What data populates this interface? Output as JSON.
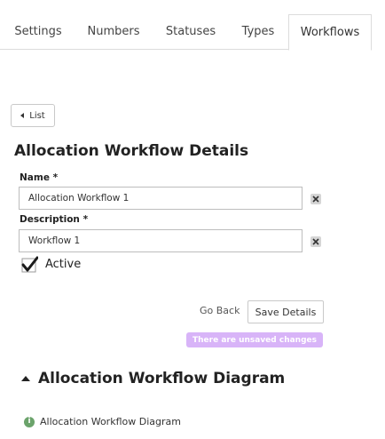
{
  "tabs": [
    {
      "label": "Settings"
    },
    {
      "label": "Numbers"
    },
    {
      "label": "Statuses"
    },
    {
      "label": "Types"
    },
    {
      "label": "Workflows"
    }
  ],
  "active_tab": "Workflows",
  "back_button": {
    "label": "List",
    "icon": "caret-left-icon"
  },
  "page_title": "Allocation Workflow Details",
  "form": {
    "name_label": "Name *",
    "name_value": "Allocation Workflow 1",
    "description_label": "Description *",
    "description_value": "Workflow 1",
    "clear_icon": "clear-x-icon",
    "active_label": "Active",
    "active_checked": true
  },
  "actions": {
    "go_back_label": "Go Back",
    "save_label": "Save Details",
    "unsaved_notice": "There are unsaved changes"
  },
  "diagram_section": {
    "title": "Allocation Workflow Diagram",
    "info_text": "Allocation Workflow Diagram",
    "expand_icon": "caret-up-icon",
    "info_icon": "info-icon"
  },
  "colors": {
    "unsaved_badge": "#d8b4f8",
    "info_icon": "#6ba36b",
    "border": "#c9c9c9"
  }
}
